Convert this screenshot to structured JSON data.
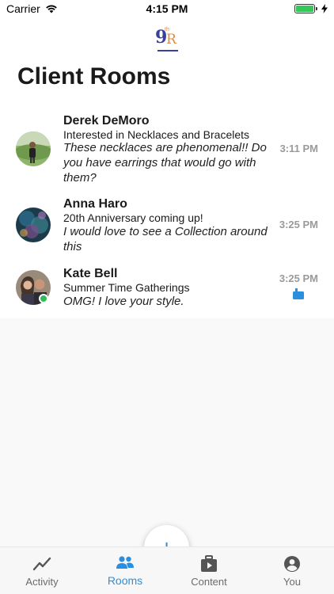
{
  "status_bar": {
    "carrier": "Carrier",
    "time": "4:15 PM",
    "battery_color": "#34c759"
  },
  "header": {
    "logo": {
      "numeral": "9",
      "superscript": "th",
      "letter": "R"
    },
    "title": "Client Rooms"
  },
  "rooms": [
    {
      "name": "Derek DeMoro",
      "topic": "Interested in Necklaces and Bracelets",
      "message": "These necklaces are phenomenal!! Do you have earrings that would go with them?",
      "time": "3:11 PM",
      "online": false,
      "unread_icon": false
    },
    {
      "name": "Anna Haro",
      "topic": "20th Anniversary coming up!",
      "message": "I would love to see a Collection around this",
      "time": "3:25 PM",
      "online": false,
      "unread_icon": false
    },
    {
      "name": "Kate Bell",
      "topic": "Summer Time Gatherings",
      "message": "OMG! I love your style.",
      "time": "3:25 PM",
      "online": true,
      "unread_icon": true
    }
  ],
  "tabs": [
    {
      "label": "Activity",
      "icon": "activity-chart-icon",
      "active": false
    },
    {
      "label": "Rooms",
      "icon": "people-icon",
      "active": true
    },
    {
      "label": "Content",
      "icon": "briefcase-play-icon",
      "active": false
    },
    {
      "label": "You",
      "icon": "user-circle-icon",
      "active": false
    }
  ],
  "fab": {
    "label": "+",
    "icon": "plus-icon"
  },
  "colors": {
    "accent": "#2b8fe0",
    "online": "#2ebd59",
    "logo_primary": "#3a3f9a",
    "logo_secondary": "#e08a3c"
  }
}
